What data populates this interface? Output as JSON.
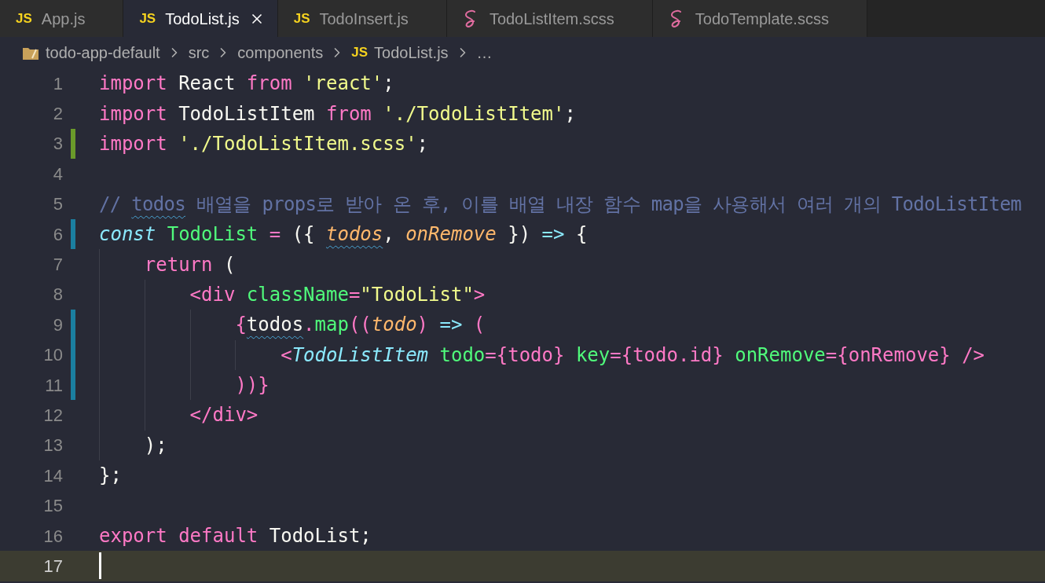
{
  "tabs": [
    {
      "label": "App.js",
      "kind": "js",
      "badge": "JS",
      "selected": false
    },
    {
      "label": "TodoList.js",
      "kind": "js",
      "badge": "JS",
      "selected": true
    },
    {
      "label": "TodoInsert.js",
      "kind": "js",
      "badge": "JS",
      "selected": false
    },
    {
      "label": "TodoListItem.scss",
      "kind": "scss",
      "selected": false
    },
    {
      "label": "TodoTemplate.scss",
      "kind": "scss",
      "selected": false
    }
  ],
  "breadcrumbs": [
    {
      "label": "todo-app-default",
      "kind": "folder"
    },
    {
      "label": "src",
      "kind": "folder-plain"
    },
    {
      "label": "components",
      "kind": "folder-plain"
    },
    {
      "label": "TodoList.js",
      "kind": "js",
      "badge": "JS"
    },
    {
      "label": "…",
      "kind": "more"
    }
  ],
  "editor": {
    "lines": [
      {
        "number": "1",
        "added": false,
        "modified": false,
        "current": false,
        "tokens": [
          {
            "text": "import",
            "kind": "keyword"
          },
          {
            "text": " React ",
            "kind": "plain"
          },
          {
            "text": "from",
            "kind": "keyword"
          },
          {
            "text": " 'react'",
            "kind": "string"
          },
          {
            "text": ";",
            "kind": "plain"
          }
        ]
      },
      {
        "number": "2",
        "added": false,
        "modified": false,
        "current": false,
        "tokens": [
          {
            "text": "import",
            "kind": "keyword"
          },
          {
            "text": " TodoListItem ",
            "kind": "plain"
          },
          {
            "text": "from",
            "kind": "keyword"
          },
          {
            "text": " './TodoListItem'",
            "kind": "string"
          },
          {
            "text": ";",
            "kind": "plain"
          }
        ]
      },
      {
        "number": "3",
        "added": true,
        "modified": false,
        "current": false,
        "tokens": [
          {
            "text": "import",
            "kind": "keyword"
          },
          {
            "text": " './TodoListItem.scss'",
            "kind": "string"
          },
          {
            "text": ";",
            "kind": "plain"
          }
        ]
      },
      {
        "number": "4",
        "added": false,
        "modified": false,
        "current": false
      },
      {
        "number": "5",
        "added": false,
        "modified": false,
        "current": false,
        "tokens": [
          {
            "text": "// ",
            "kind": "comment"
          },
          {
            "text": "todos",
            "kind": "comment",
            "warning": true
          },
          {
            "text": " 배열을 props로 받아 온 후, 이를 배열 내장 함수 map을 사용해서 여러 개의 TodoListItem",
            "kind": "comment"
          }
        ]
      },
      {
        "number": "6",
        "added": false,
        "modified": true,
        "current": false,
        "tokens": [
          {
            "text": "const",
            "kind": "storage"
          },
          {
            "text": " TodoList",
            "kind": "function"
          },
          {
            "text": " =",
            "kind": "keyword"
          },
          {
            "text": " ({ ",
            "kind": "plain"
          },
          {
            "text": "todos",
            "kind": "param",
            "warning": true
          },
          {
            "text": ", ",
            "kind": "plain"
          },
          {
            "text": "onRemove",
            "kind": "param"
          },
          {
            "text": " }) ",
            "kind": "plain"
          },
          {
            "text": "=>",
            "kind": "arrow"
          },
          {
            "text": " {",
            "kind": "plain"
          }
        ]
      },
      {
        "number": "7",
        "added": false,
        "modified": false,
        "current": false,
        "tokens": [
          {
            "text": "    return",
            "kind": "keyword"
          },
          {
            "text": " (",
            "kind": "plain"
          }
        ]
      },
      {
        "number": "8",
        "added": false,
        "modified": false,
        "current": false,
        "tokens": [
          {
            "text": "        <div",
            "kind": "keyword"
          },
          {
            "text": " className",
            "kind": "function"
          },
          {
            "text": "=",
            "kind": "keyword"
          },
          {
            "text": "\"TodoList\"",
            "kind": "string"
          },
          {
            "text": ">",
            "kind": "keyword"
          }
        ]
      },
      {
        "number": "9",
        "added": false,
        "modified": true,
        "current": false,
        "tokens": [
          {
            "text": "            {",
            "kind": "keyword"
          },
          {
            "text": "todos",
            "kind": "plain",
            "warning": true
          },
          {
            "text": ".",
            "kind": "keyword"
          },
          {
            "text": "map",
            "kind": "function"
          },
          {
            "text": "((",
            "kind": "keyword"
          },
          {
            "text": "todo",
            "kind": "param"
          },
          {
            "text": ") ",
            "kind": "keyword"
          },
          {
            "text": "=>",
            "kind": "arrow"
          },
          {
            "text": " (",
            "kind": "keyword"
          }
        ]
      },
      {
        "number": "10",
        "added": false,
        "modified": true,
        "current": false,
        "tokens": [
          {
            "text": "                <",
            "kind": "keyword"
          },
          {
            "text": "TodoListItem",
            "kind": "component"
          },
          {
            "text": " todo",
            "kind": "function"
          },
          {
            "text": "={",
            "kind": "keyword"
          },
          {
            "text": "todo",
            "kind": "plain-pink"
          },
          {
            "text": "}",
            "kind": "keyword"
          },
          {
            "text": " key",
            "kind": "function"
          },
          {
            "text": "={todo.id}",
            "kind": "keyword"
          },
          {
            "text": " onRemove",
            "kind": "function"
          },
          {
            "text": "={onRemove} />",
            "kind": "keyword"
          }
        ]
      },
      {
        "number": "11",
        "added": false,
        "modified": true,
        "current": false,
        "tokens": [
          {
            "text": "            ))}",
            "kind": "keyword"
          }
        ]
      },
      {
        "number": "12",
        "added": false,
        "modified": false,
        "current": false,
        "tokens": [
          {
            "text": "        </div>",
            "kind": "keyword"
          }
        ]
      },
      {
        "number": "13",
        "added": false,
        "modified": false,
        "current": false,
        "tokens": [
          {
            "text": "    );",
            "kind": "plain"
          }
        ]
      },
      {
        "number": "14",
        "added": false,
        "modified": false,
        "current": false,
        "tokens": [
          {
            "text": "};",
            "kind": "plain"
          }
        ]
      },
      {
        "number": "15",
        "added": false,
        "modified": false,
        "current": false
      },
      {
        "number": "16",
        "added": false,
        "modified": false,
        "current": false,
        "tokens": [
          {
            "text": "export",
            "kind": "keyword"
          },
          {
            "text": " default",
            "kind": "keyword"
          },
          {
            "text": " TodoList;",
            "kind": "plain"
          }
        ]
      },
      {
        "number": "17",
        "added": false,
        "modified": false,
        "current": true
      }
    ]
  }
}
